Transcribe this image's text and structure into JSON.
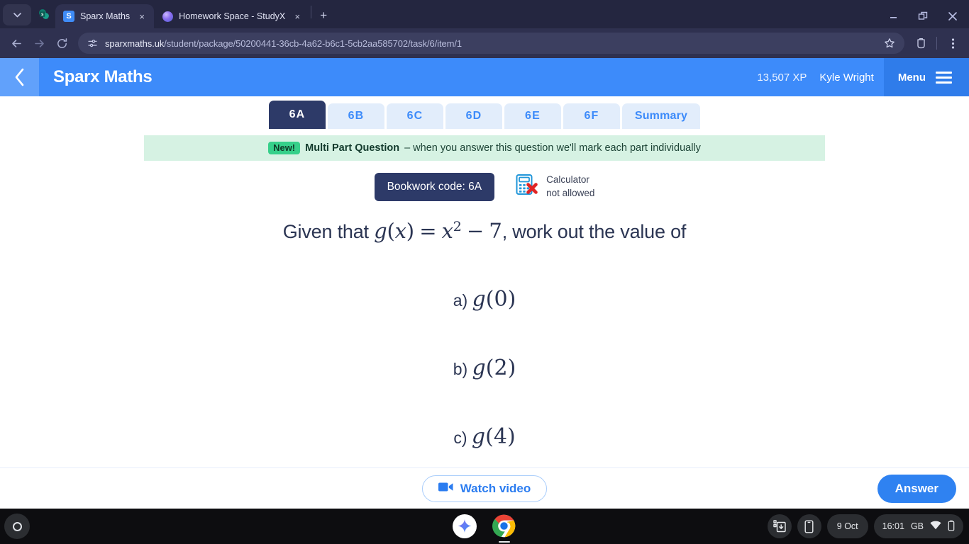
{
  "browser": {
    "tabs": [
      {
        "title": "Sparx Maths",
        "favicon": "sparx-favicon",
        "active": true
      },
      {
        "title": "Homework Space - StudyX",
        "favicon": "studyx-favicon",
        "active": false
      }
    ],
    "pinned_tab_name": "sharepoint-pinned-tab",
    "new_tab_label": "+",
    "close_label": "×",
    "omnibox": {
      "url_host": "sparxmaths.uk",
      "url_path": "/student/package/50200441-36cb-4a62-b6c1-5cb2aa585702/task/6/item/1",
      "site_info_icon": "page-info-icon",
      "bookmark_icon": "star-icon",
      "extensions_icon": "extensions-icon",
      "menu_icon": "three-dot-menu-icon"
    },
    "nav": {
      "back": "←",
      "forward": "→",
      "reload": "↻"
    },
    "window_controls": {
      "minimize": "minimize-icon",
      "restore": "restore-icon",
      "close": "close-icon"
    }
  },
  "sparx": {
    "back_label": "back-chevron",
    "logo": "Sparx Maths",
    "xp": "13,507 XP",
    "user": "Kyle Wright",
    "menu_label": "Menu",
    "question_tabs": [
      {
        "label": "6A",
        "active": true
      },
      {
        "label": "6B",
        "active": false
      },
      {
        "label": "6C",
        "active": false
      },
      {
        "label": "6D",
        "active": false
      },
      {
        "label": "6E",
        "active": false
      },
      {
        "label": "6F",
        "active": false
      },
      {
        "label": "Summary",
        "active": false
      }
    ],
    "banner": {
      "badge": "New!",
      "bold": "Multi Part Question",
      "text": "– when you answer this question we'll mark each part individually",
      "badge_color": "#36d08a",
      "background_color": "#d6f2e3"
    },
    "bookwork_code": "Bookwork code: 6A",
    "calculator": {
      "line1": "Calculator",
      "line2": "not allowed",
      "icon": "calculator-not-allowed-icon"
    },
    "question": {
      "prefix": "Given that ",
      "fn_name": "g",
      "fn_open": "(",
      "fn_var": "x",
      "fn_close": ")",
      "equals": "=",
      "rhs_var": "x",
      "rhs_exp": "2",
      "minus": "−",
      "rhs_const": "7",
      "suffix": ", work out the value of",
      "parts": [
        {
          "label": "a)",
          "fn": "g",
          "open": "(",
          "arg": "0",
          "close": ")"
        },
        {
          "label": "b)",
          "fn": "g",
          "open": "(",
          "arg": "2",
          "close": ")"
        },
        {
          "label": "c)",
          "fn": "g",
          "open": "(",
          "arg": "4",
          "close": ")"
        }
      ]
    },
    "footer": {
      "watch_video": "Watch video",
      "watch_video_icon": "video-camera-icon",
      "answer": "Answer",
      "answer_color": "#2f82f1"
    }
  },
  "shelf": {
    "launcher_name": "launcher-button",
    "apps": [
      {
        "name": "gemini-app-icon"
      },
      {
        "name": "chrome-app-icon",
        "running": true
      }
    ],
    "tray": {
      "screen_capture_icon": "screen-capture-icon",
      "phone_hub_icon": "phone-hub-icon",
      "date": "9 Oct",
      "time": "16:01",
      "locale": "GB",
      "wifi_icon": "wifi-icon",
      "battery_icon": "battery-icon"
    }
  }
}
